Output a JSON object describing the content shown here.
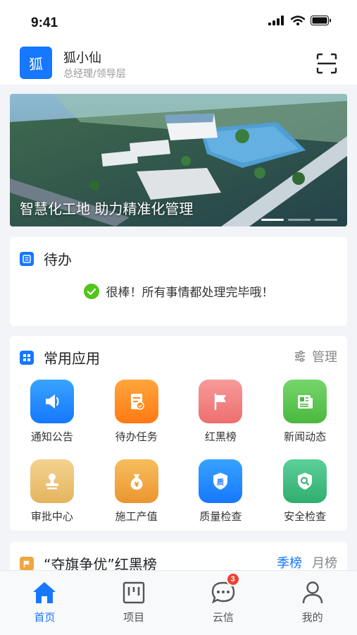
{
  "status": {
    "time": "9:41"
  },
  "header": {
    "avatar_text": "狐",
    "name": "狐小仙",
    "role": "总经理/领导层"
  },
  "banner": {
    "caption": "智慧化工地 助力精准化管理",
    "slide_count": 3,
    "active_slide": 0
  },
  "todo": {
    "title": "待办",
    "message": "很棒！所有事情都处理完毕哦！"
  },
  "apps": {
    "title": "常用应用",
    "manage_label": "管理",
    "items": [
      {
        "label": "通知公告",
        "icon": "megaphone-icon",
        "color": "#1a8cff"
      },
      {
        "label": "待办任务",
        "icon": "task-doc-icon",
        "color": "#ff8a1f"
      },
      {
        "label": "红黑榜",
        "icon": "flag-icon",
        "color": "#f27b7b"
      },
      {
        "label": "新闻动态",
        "icon": "newspaper-icon",
        "color": "#5cc94f"
      },
      {
        "label": "审批中心",
        "icon": "stamp-icon",
        "color": "#ecc472"
      },
      {
        "label": "施工产值",
        "icon": "money-bag-icon",
        "color": "#f0a640"
      },
      {
        "label": "质量检查",
        "icon": "quality-shield-icon",
        "color": "#1a8cff"
      },
      {
        "label": "安全检查",
        "icon": "safety-shield-icon",
        "color": "#3cb97a"
      }
    ]
  },
  "ranking": {
    "title": "“夺旗争优”红黑榜",
    "tabs": [
      "季榜",
      "月榜"
    ],
    "active_tab": 0
  },
  "tabbar": {
    "items": [
      {
        "label": "首页",
        "icon": "home-icon"
      },
      {
        "label": "项目",
        "icon": "project-board-icon"
      },
      {
        "label": "云信",
        "icon": "chat-bubble-icon",
        "badge": "3"
      },
      {
        "label": "我的",
        "icon": "user-icon"
      }
    ],
    "active": 0
  },
  "colors": {
    "accent": "#1677ff",
    "success": "#52c41a",
    "badge": "#f04134"
  }
}
